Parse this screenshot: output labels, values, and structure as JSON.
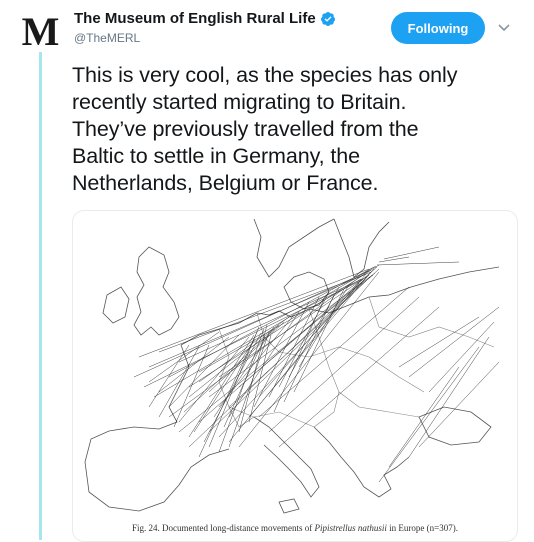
{
  "account": {
    "display_name": "The Museum of English Rural Life",
    "handle": "@TheMERL",
    "avatar_letter": "M",
    "verified": true
  },
  "follow_button": {
    "label": "Following"
  },
  "menu": {
    "icon": "chevron-down-icon"
  },
  "tweet": {
    "lines": [
      "This is very cool, as the species has only",
      "recently started migrating to Britain.",
      "They’ve previously travelled from the",
      "Baltic to settle in Germany, the",
      "Netherlands, Belgium or France."
    ]
  },
  "media": {
    "caption_prefix": "Fig. 24.   Documented long-distance movements of ",
    "caption_species": "Pipistrellus nathusii",
    "caption_suffix": " in Europe (n=307)."
  },
  "colors": {
    "accent": "#1da1f2",
    "thread_line": "#a7e6ef",
    "handle_grey": "#657786"
  }
}
